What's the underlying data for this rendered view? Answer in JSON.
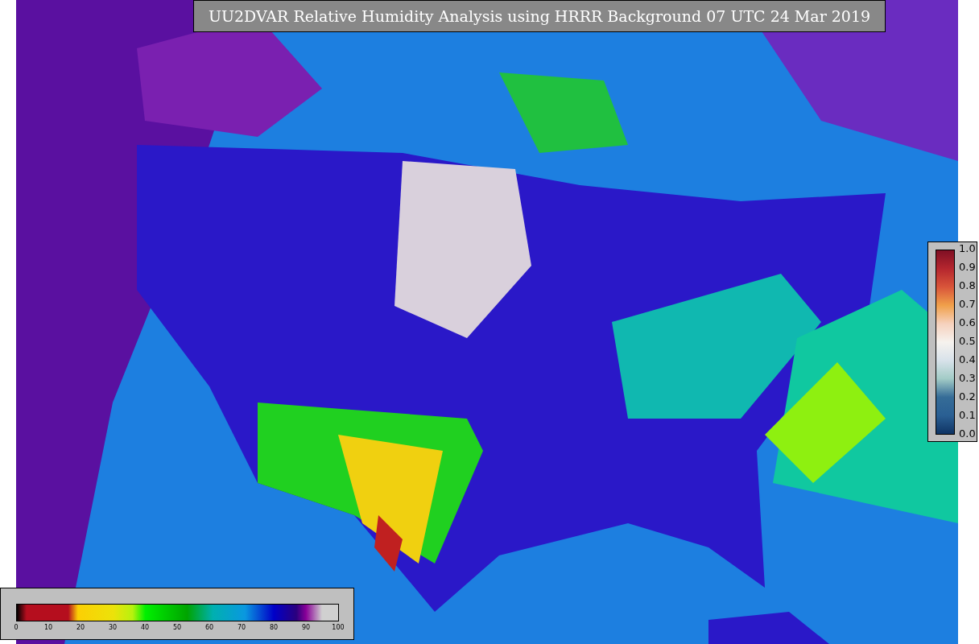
{
  "title": "UU2DVAR Relative Humidity Analysis using HRRR Background 07 UTC 24 Mar 2019",
  "right_colorbar": {
    "ticks": [
      "1.0",
      "0.9",
      "0.8",
      "0.7",
      "0.6",
      "0.5",
      "0.4",
      "0.3",
      "0.2",
      "0.1",
      "0.0"
    ]
  },
  "bottom_colorbar": {
    "ticks": [
      "0",
      "10",
      "20",
      "30",
      "40",
      "50",
      "60",
      "70",
      "80",
      "90",
      "100"
    ]
  }
}
